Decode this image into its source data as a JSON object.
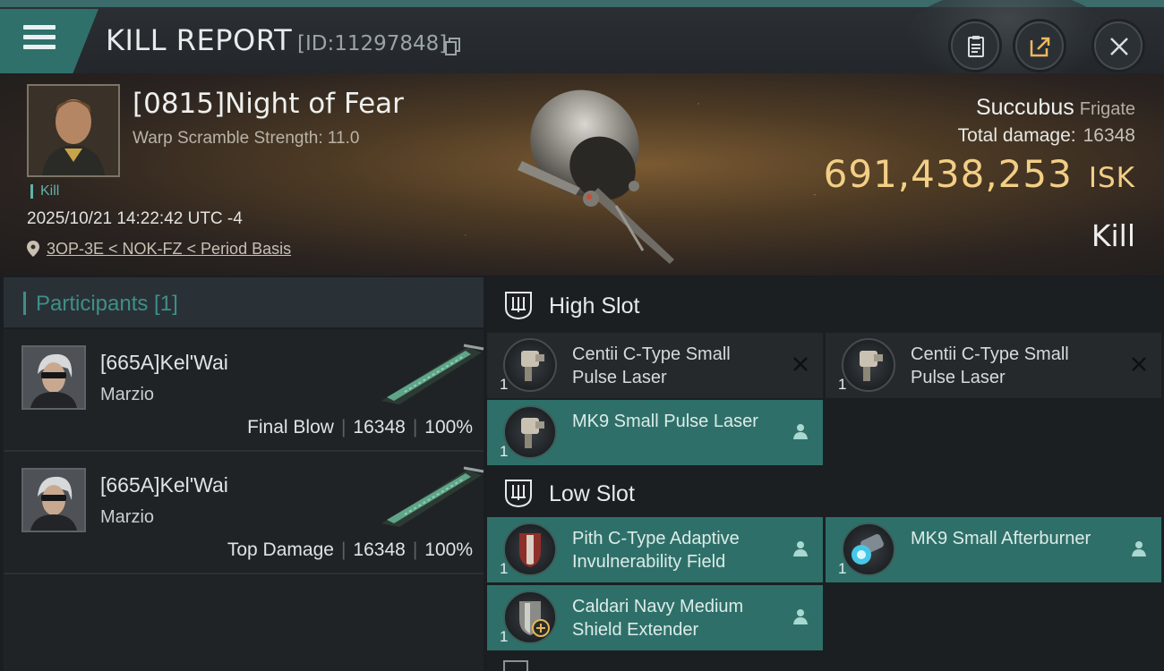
{
  "header": {
    "title": "KILL REPORT",
    "report_id": "[ID:11297848]",
    "icons": [
      "menu-icon",
      "copy-icon",
      "clipboard-icon",
      "share-icon",
      "close-icon"
    ]
  },
  "victim": {
    "name": "[0815]Night of Fear",
    "warp_scramble": "Warp Scramble Strength: 11.0",
    "kill_tag": "Kill",
    "timestamp": "2025/10/21 14:22:42 UTC -4",
    "location": "3OP-3E < NOK-FZ < Period Basis",
    "ship_name": "Succubus",
    "ship_class": "Frigate",
    "total_damage_label": "Total damage:",
    "total_damage": "16348",
    "isk_value": "691,438,253",
    "isk_unit": "ISK",
    "result": "Kill"
  },
  "participants": {
    "header": "Participants [1]",
    "rows": [
      {
        "name": "[665A]Kel'Wai",
        "corp": "Marzio",
        "role": "Final Blow",
        "damage": "16348",
        "percent": "100%"
      },
      {
        "name": "[665A]Kel'Wai",
        "corp": "Marzio",
        "role": "Top Damage",
        "damage": "16348",
        "percent": "100%"
      }
    ]
  },
  "fittings": {
    "high_slot_label": "High Slot",
    "low_slot_label": "Low Slot",
    "high_slot": [
      {
        "name": "Centii C-Type Small Pulse Laser",
        "qty": "1",
        "status": "destroyed"
      },
      {
        "name": "Centii C-Type Small Pulse Laser",
        "qty": "1",
        "status": "destroyed"
      },
      {
        "name": "MK9 Small Pulse Laser",
        "qty": "1",
        "status": "dropped"
      }
    ],
    "low_slot": [
      {
        "name": "Pith C-Type Adaptive Invulnerability Field",
        "qty": "1",
        "status": "dropped"
      },
      {
        "name": "MK9 Small Afterburner",
        "qty": "1",
        "status": "dropped"
      },
      {
        "name": "Caldari Navy Medium Shield Extender",
        "qty": "1",
        "status": "dropped"
      }
    ]
  },
  "colors": {
    "accent_teal": "#2e7069",
    "isk_gold": "#f2cf85",
    "participants_header": "#3e8f88"
  }
}
